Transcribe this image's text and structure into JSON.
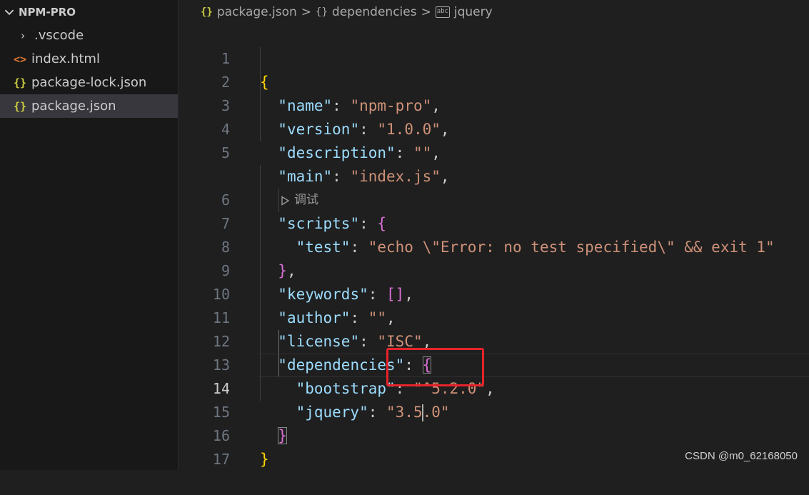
{
  "explorer": {
    "folder_name": "NPM-PRO",
    "items": [
      {
        "label": ".vscode",
        "icon": "chevron-right-icon",
        "glyph": "›",
        "type": "folder"
      },
      {
        "label": "index.html",
        "icon": "html-file-icon",
        "glyph": "<>",
        "type": "html"
      },
      {
        "label": "package-lock.json",
        "icon": "json-file-icon",
        "glyph": "{}",
        "type": "json"
      },
      {
        "label": "package.json",
        "icon": "json-file-icon",
        "glyph": "{}",
        "type": "json",
        "active": true
      }
    ]
  },
  "breadcrumb": {
    "file": "package.json",
    "object": "dependencies",
    "property": "jquery",
    "file_glyph": "{}",
    "object_glyph": "{}",
    "separator": ">",
    "string_glyph": "abc"
  },
  "code": {
    "line_numbers": [
      "1",
      "2",
      "3",
      "4",
      "5",
      "6",
      "7",
      "8",
      "9",
      "10",
      "11",
      "12",
      "13",
      "14",
      "15",
      "16",
      "17"
    ],
    "current_line": "14",
    "codelens": "调试",
    "tokens": {
      "l1_open": "{",
      "name_key": "\"name\"",
      "name_val": "\"npm-pro\"",
      "version_key": "\"version\"",
      "version_val": "\"1.0.0\"",
      "description_key": "\"description\"",
      "description_val": "\"\"",
      "main_key": "\"main\"",
      "main_val": "\"index.js\"",
      "scripts_key": "\"scripts\"",
      "scripts_open": "{",
      "test_key": "\"test\"",
      "test_val": "\"echo \\\"Error: no test specified\\\" && exit 1\"",
      "scripts_close": "}",
      "keywords_key": "\"keywords\"",
      "keywords_val": "[]",
      "author_key": "\"author\"",
      "author_val": "\"\"",
      "license_key": "\"license\"",
      "license_val": "\"ISC\"",
      "deps_key": "\"dependencies\"",
      "deps_open": "{",
      "bootstrap_key": "\"bootstrap\"",
      "bootstrap_val": "\"^5.2.0\"",
      "jquery_key": "\"jquery\"",
      "jquery_val_before": "\"3.5",
      "jquery_val_after": ".0\"",
      "deps_close": "}",
      "l16_close": "}",
      "colon": ": ",
      "comma": ","
    }
  },
  "watermark": "CSDN @m0_62168050",
  "colors": {
    "key": "#9cdcfe",
    "string": "#ce9178",
    "bracket_level1": "#ffd700",
    "bracket_level2": "#da70d6",
    "highlight_box": "#e8232a"
  }
}
